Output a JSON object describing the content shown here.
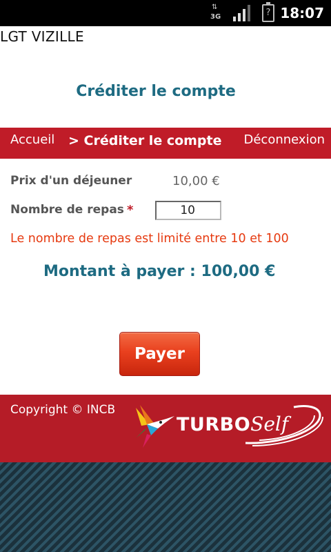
{
  "status_bar": {
    "network_label": "3G",
    "time": "18:07",
    "battery_label": "?",
    "icons": [
      "data-arrows-icon",
      "signal-icon",
      "battery-unknown-icon"
    ]
  },
  "site": {
    "name": "LGT VIZILLE"
  },
  "page": {
    "title": "Créditer le compte"
  },
  "nav": {
    "home": "Accueil",
    "current": "> Créditer le compte",
    "logout": "Déconnexion"
  },
  "form": {
    "price_label": "Prix d'un déjeuner",
    "price_value": "10,00 €",
    "meals_label": "Nombre de repas",
    "required_mark": "*",
    "meals_value": "10",
    "limit_message": "Le nombre de repas est limité entre 10 et 100",
    "amount_text": "Montant à payer : 100,00 €"
  },
  "actions": {
    "pay_label": "Payer"
  },
  "footer": {
    "copyright": "Copyright © INCB",
    "brand_turbo": "TURBO",
    "brand_self": "Self"
  },
  "colors": {
    "accent_red": "#c01c28",
    "title_teal": "#1e6b82",
    "error_orange": "#e63a10",
    "button_orange": "#e9401e",
    "pattern_dark": "#24404d"
  }
}
